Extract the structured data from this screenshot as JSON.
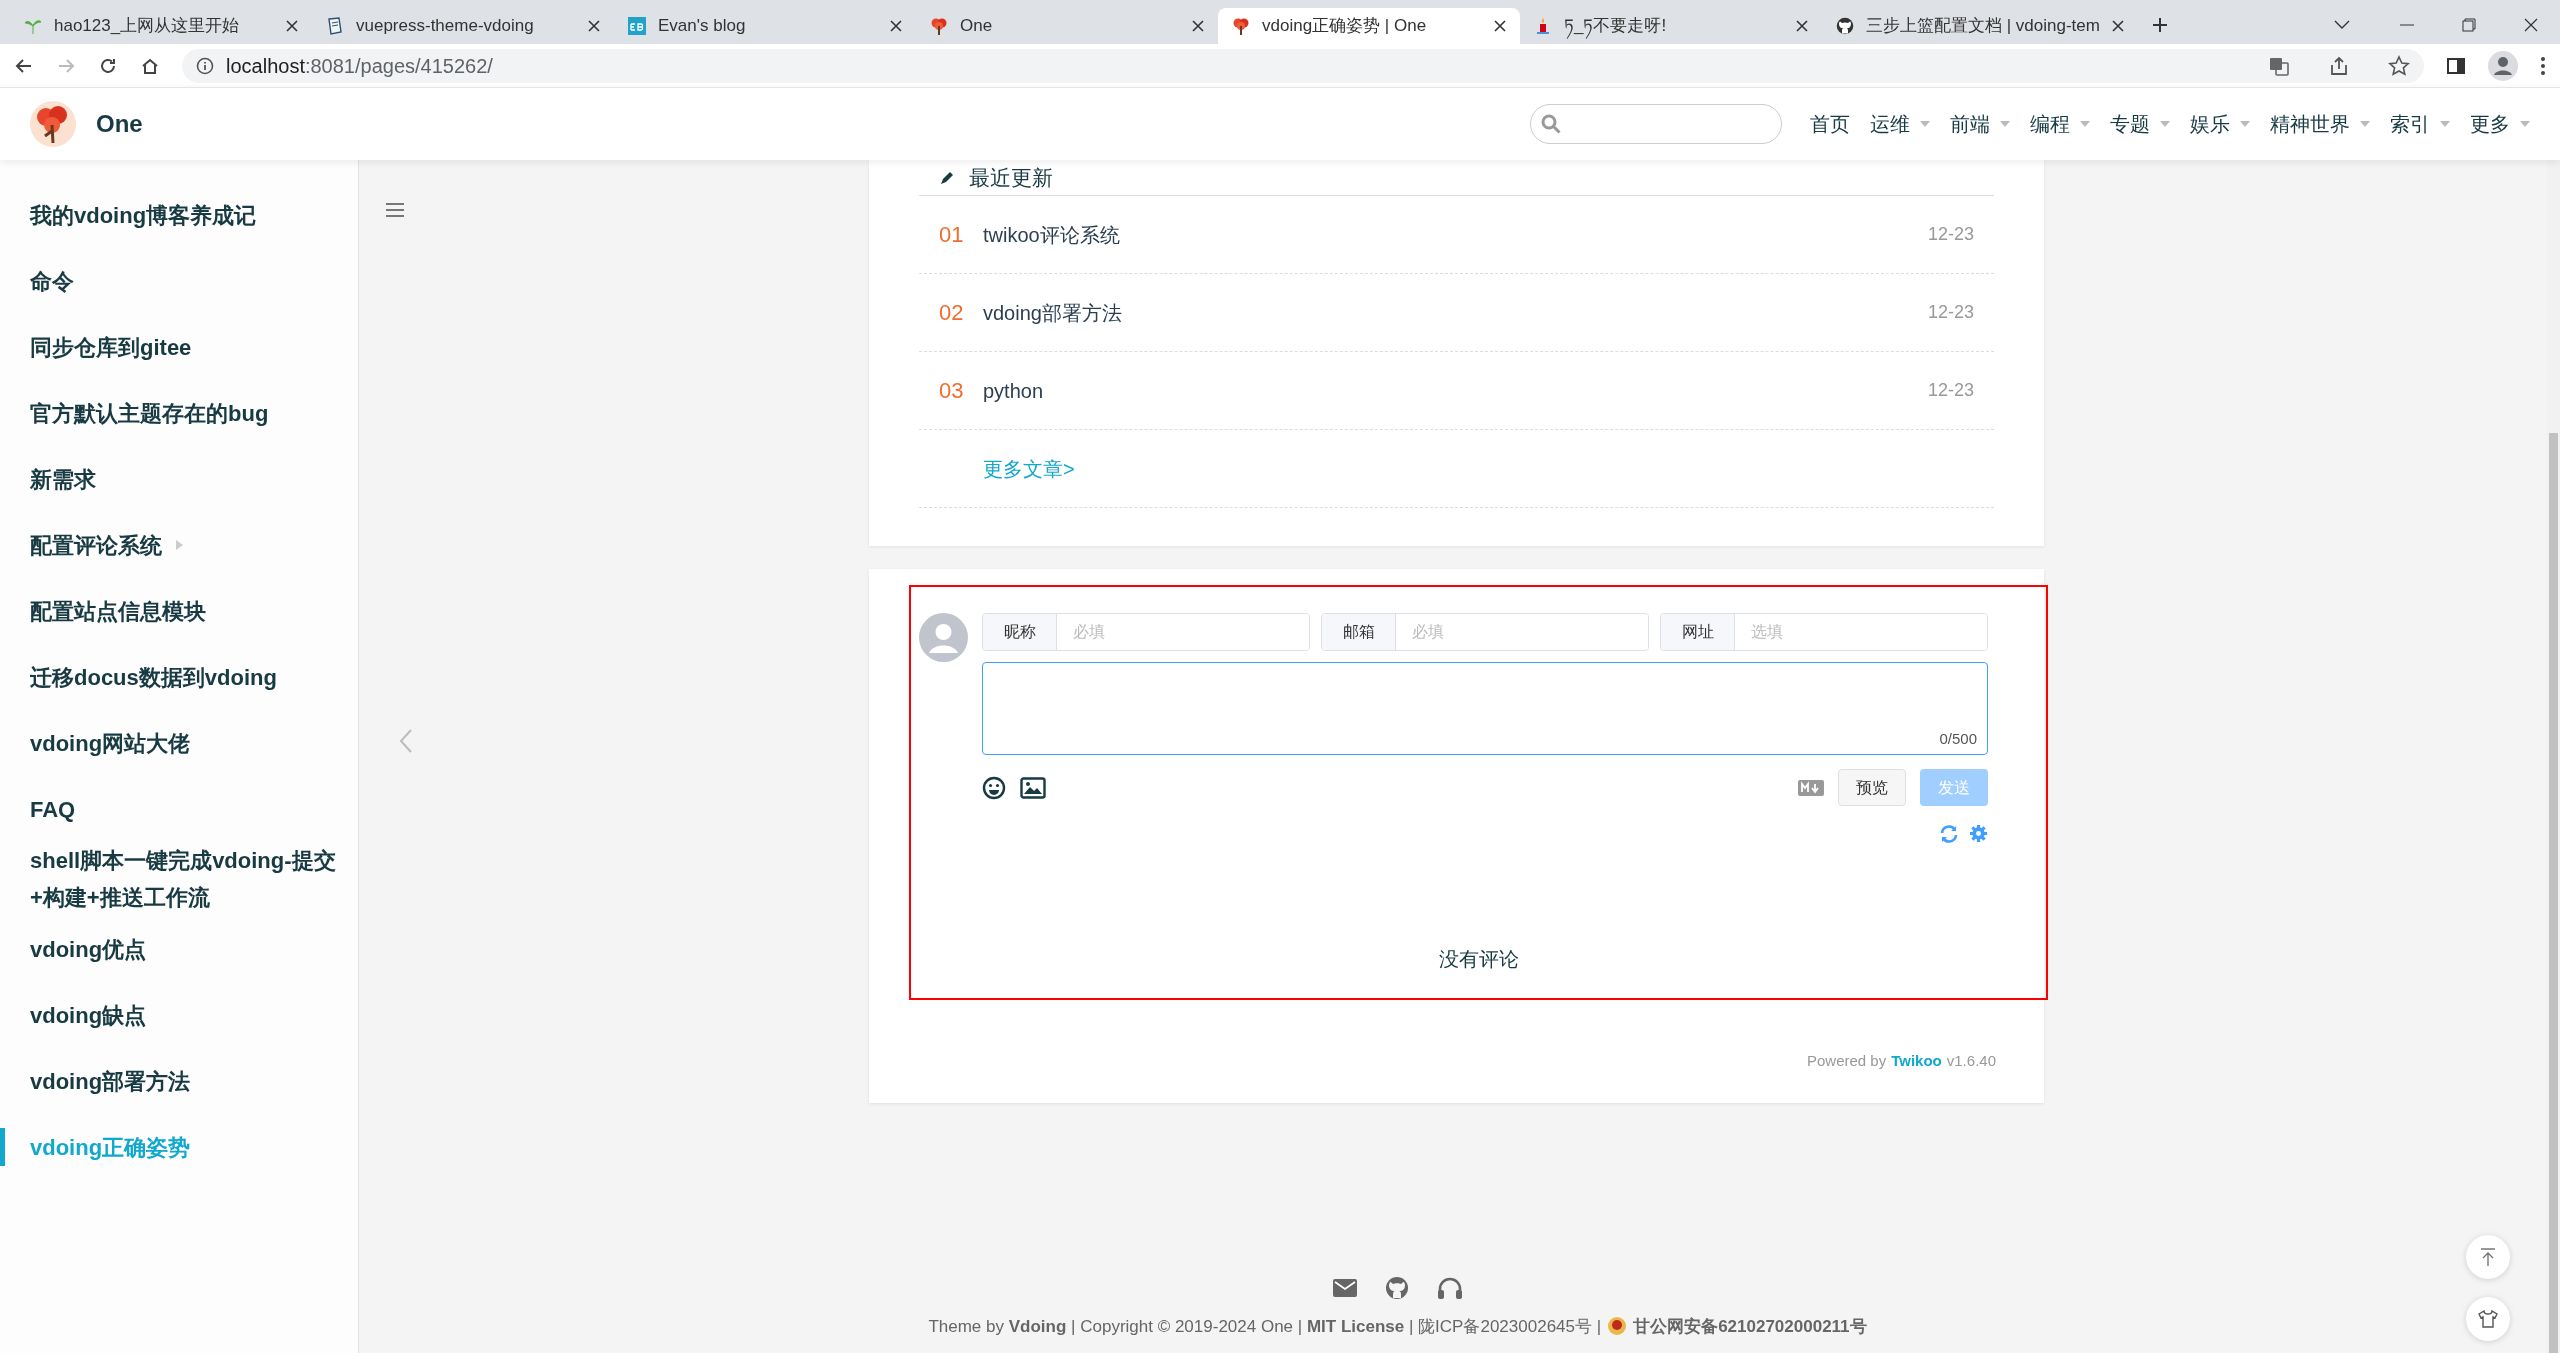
{
  "browser": {
    "tabs": [
      {
        "title": "hao123_上网从这里开始",
        "selected": false
      },
      {
        "title": "vuepress-theme-vdoing",
        "selected": false
      },
      {
        "title": "Evan's blog",
        "selected": false
      },
      {
        "title": "One",
        "selected": false
      },
      {
        "title": "vdoing正确姿势 | One",
        "selected": true
      },
      {
        "title": "ཏ_ཏ不要走呀!",
        "selected": false
      },
      {
        "title": "三步上篮配置文档 | vdoing-tem",
        "selected": false
      }
    ],
    "address": {
      "host": "localhost",
      "rest": ":8081/pages/415262/"
    }
  },
  "navbar": {
    "site_title": "One",
    "items": [
      {
        "label": "首页",
        "dropdown": false
      },
      {
        "label": "运维",
        "dropdown": true
      },
      {
        "label": "前端",
        "dropdown": true
      },
      {
        "label": "编程",
        "dropdown": true
      },
      {
        "label": "专题",
        "dropdown": true
      },
      {
        "label": "娱乐",
        "dropdown": true
      },
      {
        "label": "精神世界",
        "dropdown": true
      },
      {
        "label": "索引",
        "dropdown": true
      },
      {
        "label": "更多",
        "dropdown": true
      }
    ]
  },
  "sidebar": {
    "items": [
      {
        "label": "我的vdoing博客养成记",
        "selected": false,
        "expandable": false
      },
      {
        "label": "命令",
        "selected": false,
        "expandable": false
      },
      {
        "label": "同步仓库到gitee",
        "selected": false,
        "expandable": false
      },
      {
        "label": "官方默认主题存在的bug",
        "selected": false,
        "expandable": false
      },
      {
        "label": "新需求",
        "selected": false,
        "expandable": false
      },
      {
        "label": "配置评论系统",
        "selected": false,
        "expandable": true
      },
      {
        "label": "配置站点信息模块",
        "selected": false,
        "expandable": false
      },
      {
        "label": "迁移docus数据到vdoing",
        "selected": false,
        "expandable": false
      },
      {
        "label": "vdoing网站大佬",
        "selected": false,
        "expandable": false
      },
      {
        "label": "FAQ",
        "selected": false,
        "expandable": false
      },
      {
        "label": "shell脚本一键完成vdoing-提交+构建+推送工作流",
        "selected": false,
        "expandable": false
      },
      {
        "label": "vdoing优点",
        "selected": false,
        "expandable": false
      },
      {
        "label": "vdoing缺点",
        "selected": false,
        "expandable": false
      },
      {
        "label": "vdoing部署方法",
        "selected": false,
        "expandable": false
      },
      {
        "label": "vdoing正确姿势",
        "selected": true,
        "expandable": false
      }
    ]
  },
  "recent": {
    "title": "最近更新",
    "items": [
      {
        "index": "01",
        "title": "twikoo评论系统",
        "date": "12-23"
      },
      {
        "index": "02",
        "title": "vdoing部署方法",
        "date": "12-23"
      },
      {
        "index": "03",
        "title": "python",
        "date": "12-23"
      }
    ],
    "more": "更多文章>"
  },
  "comments": {
    "fields": [
      {
        "label": "昵称",
        "placeholder": "必填"
      },
      {
        "label": "邮箱",
        "placeholder": "必填"
      },
      {
        "label": "网址",
        "placeholder": "选填"
      }
    ],
    "counter": "0/500",
    "preview": "预览",
    "send": {
      "label": "发送",
      "disabled": true
    },
    "empty": "没有评论",
    "powered_prefix": "Powered by",
    "powered_link": "Twikoo",
    "powered_version": "v1.6.40"
  },
  "footer": {
    "text": "Theme by **Vdoing** | Copyright © 2019-2024 One | **MIT License** | 陇ICP备2023002645号 |",
    "police": "甘公网安备62102702000211号"
  }
}
